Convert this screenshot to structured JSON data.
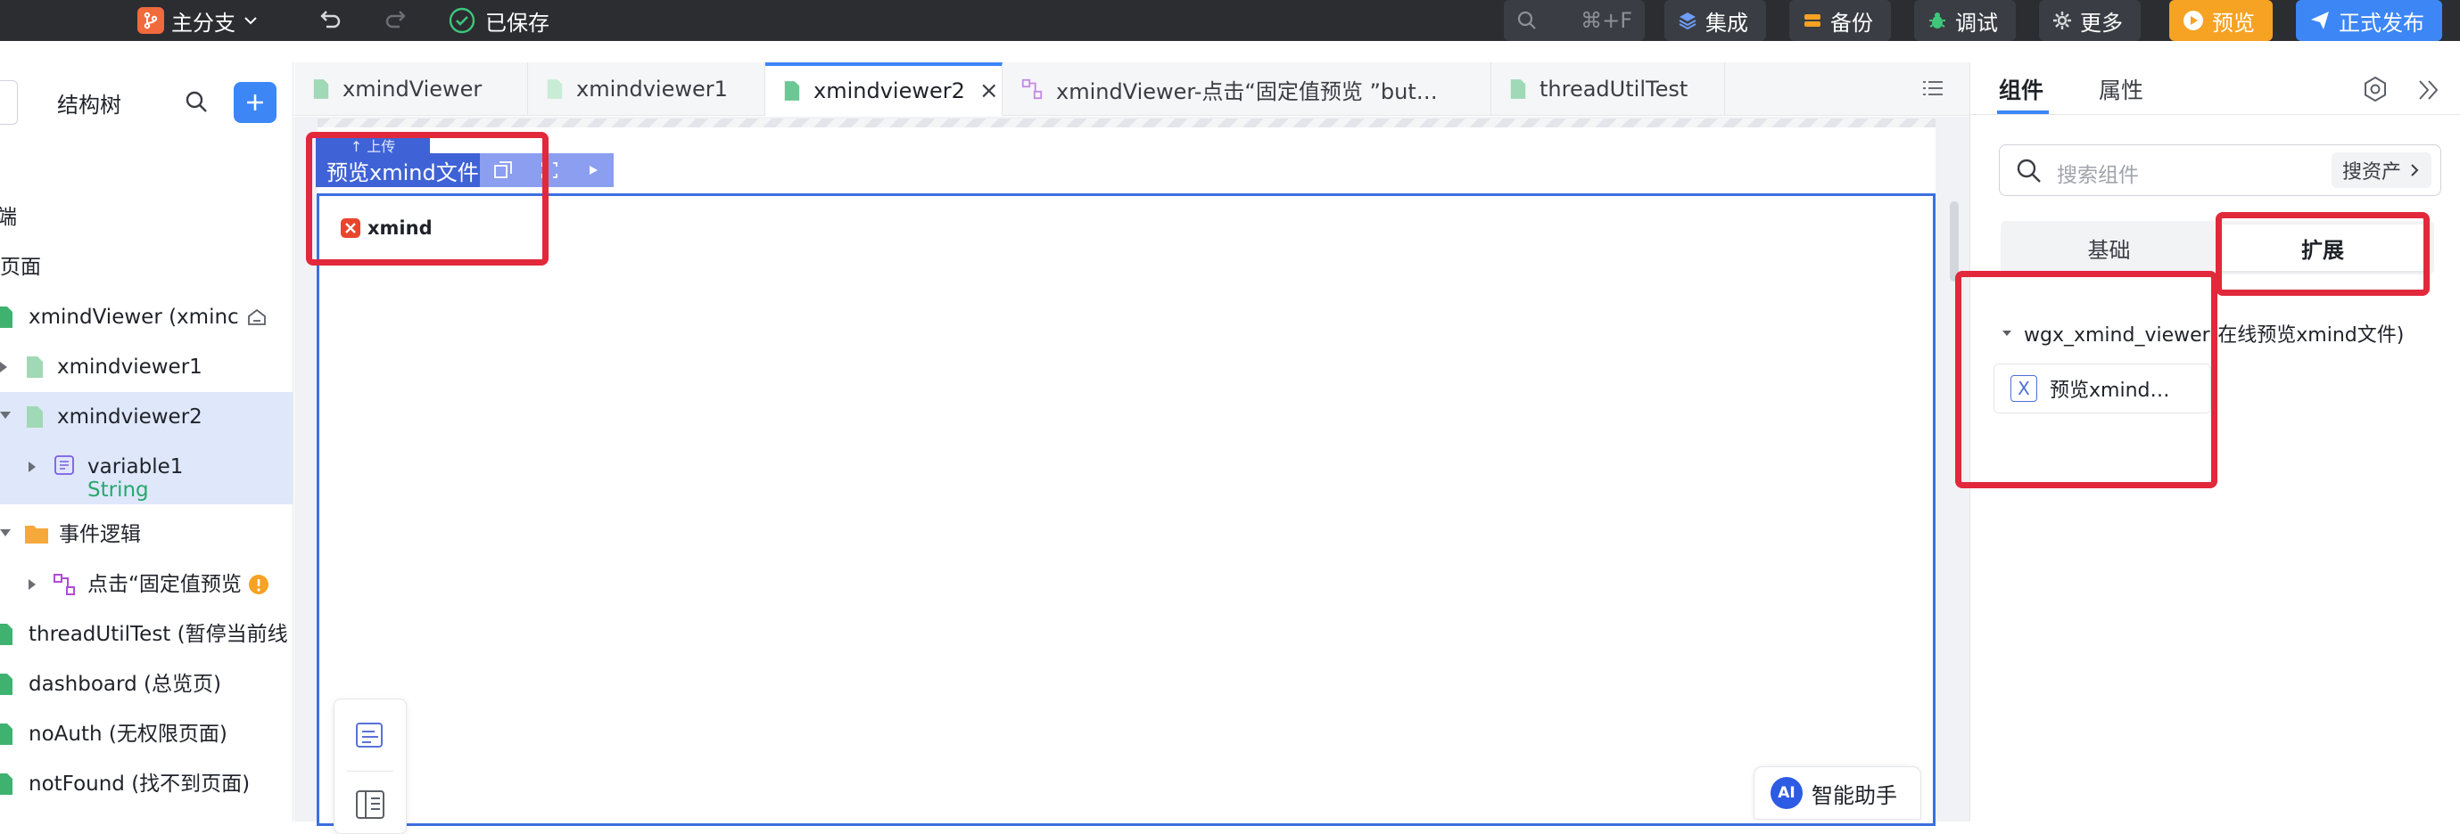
{
  "topbar": {
    "branch_label": "主分支",
    "saved_label": "已保存",
    "search_shortcut": "⌘+F",
    "integrate_label": "集成",
    "backup_label": "备份",
    "debug_label": "调试",
    "more_label": "更多",
    "preview_label": "预览",
    "publish_label": "正式发布"
  },
  "left_panel": {
    "title": "结构树",
    "tree": [
      {
        "label": "端"
      },
      {
        "label": "页面"
      },
      {
        "label": "xmindViewer (xminc"
      },
      {
        "label": "xmindviewer1"
      },
      {
        "label": "xmindviewer2"
      },
      {
        "label": "variable1",
        "type": "String"
      },
      {
        "label": "事件逻辑"
      },
      {
        "label": "点击“固定值预览"
      },
      {
        "label": "threadUtilTest (暂停当前线"
      },
      {
        "label": "dashboard (总览页)"
      },
      {
        "label": "noAuth (无权限页面)"
      },
      {
        "label": "notFound (找不到页面)"
      }
    ]
  },
  "tabs": [
    {
      "label": "xmindViewer"
    },
    {
      "label": "xmindviewer1"
    },
    {
      "label": "xmindviewer2"
    },
    {
      "label": "xmindViewer-点击“固定值预览 ”but…"
    },
    {
      "label": "threadUtilTest"
    }
  ],
  "canvas": {
    "upload_tag": "↑ 上传",
    "component_tag": "预览xmind文件",
    "logo_text": "xmind",
    "ai_label": "智能助手",
    "ai_badge": "AI"
  },
  "right_panel": {
    "tab_components": "组件",
    "tab_properties": "属性",
    "search_placeholder": "搜索组件",
    "assets_label": "搜资产",
    "seg_basic": "基础",
    "seg_extend": "扩展",
    "group_title": "wgx_xmind_viewer(在线预览xmind文件)",
    "component_card": "预览xmind…",
    "component_icon": "X"
  },
  "colors": {
    "accent": "#3c86f6",
    "highlight": "#e2283b",
    "preview": "#f6a223",
    "topbar": "#2b2d31"
  }
}
